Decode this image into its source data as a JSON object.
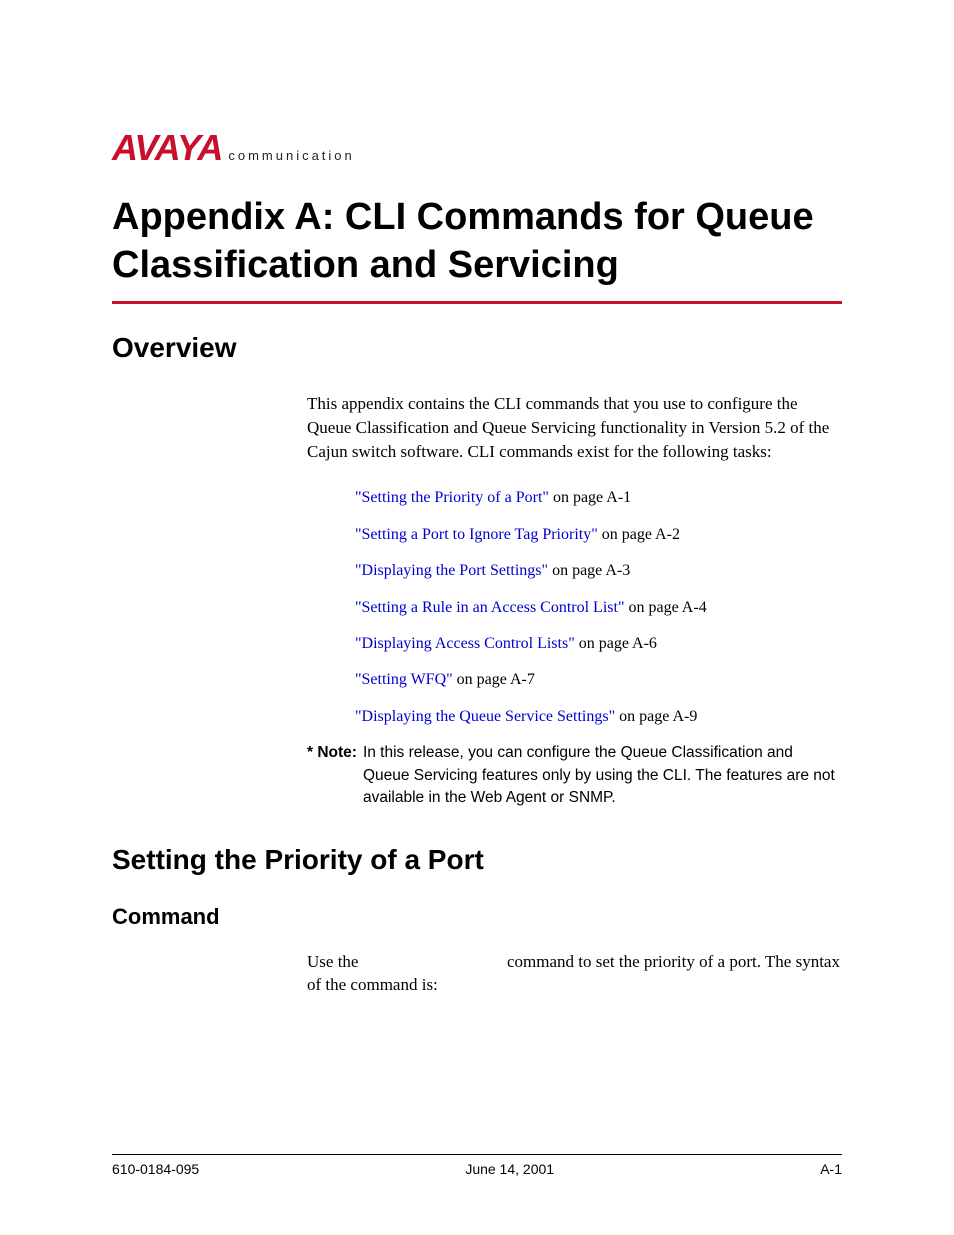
{
  "logo": {
    "brand": "AVAYA",
    "sub": "communication"
  },
  "title": "Appendix A: CLI Commands for Queue Classification and Servicing",
  "sections": {
    "overview": {
      "heading": "Overview",
      "intro": "This appendix contains the CLI commands that you use to configure the Queue Classification and Queue Servicing functionality in Version 5.2 of the Cajun switch software. CLI commands exist for the following tasks:",
      "links": [
        {
          "text": "\"Setting the Priority of a Port\"",
          "suffix": " on page A-1"
        },
        {
          "text": "\"Setting a Port to Ignore Tag Priority\"",
          "suffix": " on page A-2"
        },
        {
          "text": "\"Displaying the Port Settings\"",
          "suffix": " on page A-3"
        },
        {
          "text": "\"Setting a Rule in an Access Control List\"",
          "suffix": " on page A-4"
        },
        {
          "text": "\"Displaying Access Control Lists\"",
          "suffix": " on page A-6"
        },
        {
          "text": "\"Setting WFQ\"",
          "suffix": " on page A-7"
        },
        {
          "text": "\"Displaying the Queue Service Settings\"",
          "suffix": " on page A-9"
        }
      ],
      "note_label": "* Note:",
      "note_text": "In this release, you can configure the Queue Classification and Queue Servicing features only by using the CLI. The features are not available in the Web Agent or SNMP."
    },
    "setting_priority": {
      "heading": "Setting the Priority of a Port",
      "subheading": "Command",
      "body_pre": "Use the ",
      "body_post": " command to set the priority of a port. The syntax of the command is:"
    }
  },
  "footer": {
    "left": "610-0184-095",
    "center": "June 14, 2001",
    "right": "A-1"
  }
}
